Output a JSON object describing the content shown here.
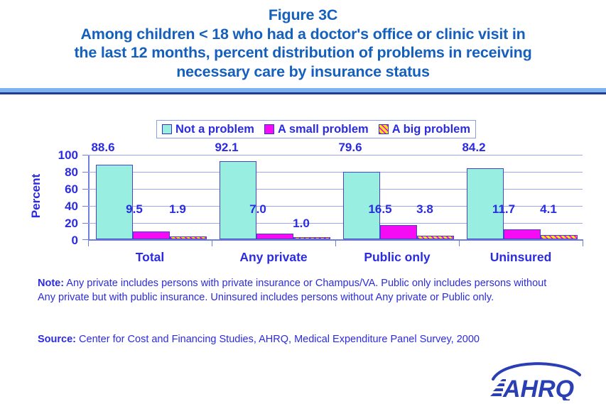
{
  "title": {
    "line1": "Figure 3C",
    "line2": "Among children < 18 who had a doctor's office or clinic visit in",
    "line3": "the last 12 months, percent distribution of problems in receiving",
    "line4": "necessary care by insurance status"
  },
  "legend": {
    "items": [
      {
        "label": "Not a problem",
        "swatch": "legend-swatch-not-a-problem",
        "color": "#99eee2"
      },
      {
        "label": "A small problem",
        "swatch": "legend-swatch-a-small-problem",
        "color": "#f50cf5"
      },
      {
        "label": "A big problem",
        "swatch": "legend-swatch-a-big-problem",
        "color": "#ffee00"
      }
    ]
  },
  "axis": {
    "y_title": "Percent",
    "ticks": [
      "100",
      "80",
      "60",
      "40",
      "20",
      "0"
    ]
  },
  "values": {
    "total": {
      "not": "88.6",
      "small": "9.5",
      "big": "1.9"
    },
    "any_private": {
      "not": "92.1",
      "small": "7.0",
      "big": "1.0"
    },
    "public_only": {
      "not": "79.6",
      "small": "16.5",
      "big": "3.8"
    },
    "uninsured": {
      "not": "84.2",
      "small": "11.7",
      "big": "4.1"
    }
  },
  "categories": [
    "Total",
    "Any private",
    "Public only",
    "Uninsured"
  ],
  "note": {
    "label": "Note:",
    "text": " Any private includes persons with private insurance or Champus/VA.  Public only includes persons without Any private but with public insurance. Uninsured includes persons without Any private or Public only."
  },
  "source": {
    "label": "Source:",
    "text": " Center for Cost and Financing Studies, AHRQ, Medical Expenditure Panel Survey, 2000"
  },
  "logo": {
    "text": "AHRQ"
  },
  "chart_data": {
    "type": "bar",
    "title": "Among children < 18 who had a doctor's office or clinic visit in the last 12 months, percent distribution of problems in receiving necessary care by insurance status",
    "subtitle": "Figure 3C",
    "xlabel": "",
    "ylabel": "Percent",
    "ylim": [
      0,
      100
    ],
    "yticks": [
      0,
      20,
      40,
      60,
      80,
      100
    ],
    "grid": true,
    "legend_position": "top-center",
    "categories": [
      "Total",
      "Any private",
      "Public only",
      "Uninsured"
    ],
    "series": [
      {
        "name": "Not a problem",
        "color": "#99eee2",
        "values": [
          88.6,
          92.1,
          79.6,
          84.2
        ]
      },
      {
        "name": "A small problem",
        "color": "#f50cf5",
        "values": [
          9.5,
          7.0,
          16.5,
          11.7
        ]
      },
      {
        "name": "A big problem",
        "color": "#ffee00",
        "values": [
          1.9,
          1.0,
          3.8,
          4.1
        ]
      }
    ],
    "annotations": [
      "Note: Any private includes persons with private insurance or Champus/VA.  Public only includes persons without Any private but with public insurance. Uninsured includes persons without Any private or Public only.",
      "Source: Center for Cost and Financing Studies, AHRQ, Medical Expenditure Panel Survey, 2000"
    ]
  }
}
